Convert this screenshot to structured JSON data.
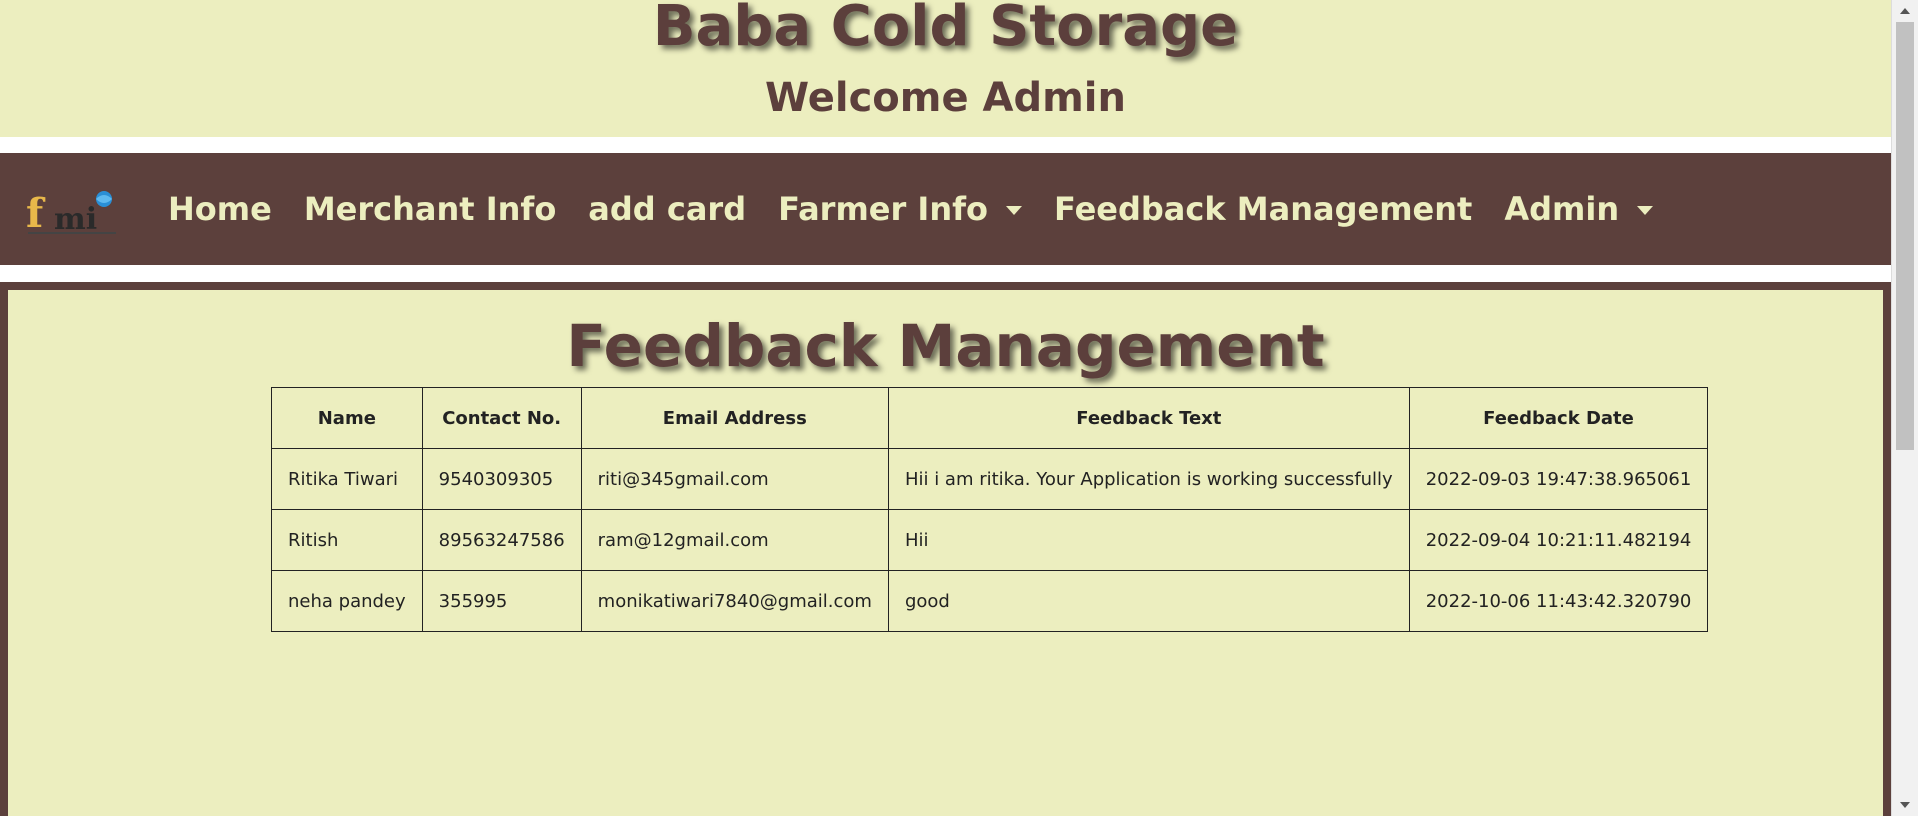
{
  "header": {
    "title": "Baba Cold Storage",
    "welcome": "Welcome Admin"
  },
  "navbar": {
    "logo_text": "fmi",
    "items": [
      {
        "label": "Home",
        "dropdown": false
      },
      {
        "label": "Merchant Info",
        "dropdown": false
      },
      {
        "label": "add card",
        "dropdown": false
      },
      {
        "label": "Farmer Info",
        "dropdown": true
      },
      {
        "label": "Feedback Management",
        "dropdown": false
      },
      {
        "label": "Admin",
        "dropdown": true
      }
    ]
  },
  "main": {
    "title": "Feedback Management",
    "table": {
      "columns": [
        "Name",
        "Contact No.",
        "Email Address",
        "Feedback Text",
        "Feedback Date"
      ],
      "rows": [
        [
          "Ritika Tiwari",
          "9540309305",
          "riti@345gmail.com",
          "Hii i am ritika. Your Application is working successfully",
          "2022-09-03 19:47:38.965061"
        ],
        [
          "Ritish",
          "89563247586",
          "ram@12gmail.com",
          "Hii",
          "2022-09-04 10:21:11.482194"
        ],
        [
          "neha pandey",
          "355995",
          "monikatiwari7840@gmail.com",
          "good",
          "2022-10-06 11:43:42.320790"
        ]
      ]
    }
  },
  "colors": {
    "brand_brown": "#5c403c",
    "cream": "#eceebf"
  }
}
